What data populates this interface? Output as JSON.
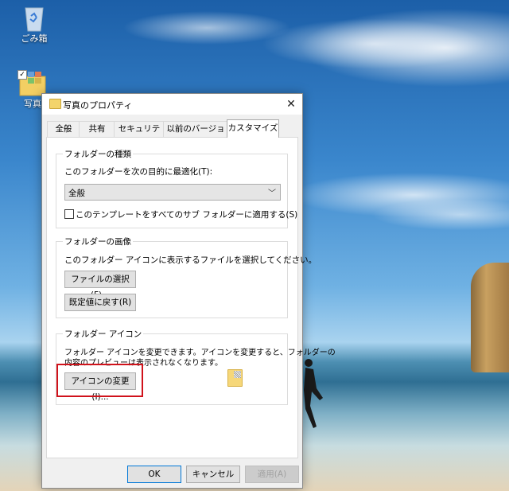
{
  "desktop": {
    "recycle_bin_label": "ごみ箱",
    "photo_folder_label": "写真"
  },
  "dialog": {
    "title": "写真のプロパティ",
    "close_glyph": "✕",
    "tabs": [
      {
        "label": "全般"
      },
      {
        "label": "共有"
      },
      {
        "label": "セキュリティ"
      },
      {
        "label": "以前のバージョン"
      },
      {
        "label": "カスタマイズ",
        "active": true
      }
    ],
    "folder_type": {
      "title": "フォルダーの種類",
      "optimize_label": "このフォルダーを次の目的に最適化(T):",
      "optimize_value": "全般",
      "apply_template_label": "このテンプレートをすべてのサブ フォルダーに適用する(S)",
      "apply_template_checked": false
    },
    "folder_picture": {
      "title": "フォルダーの画像",
      "description": "このフォルダー アイコンに表示するファイルを選択してください。",
      "choose_file_button": "ファイルの選択(F)...",
      "restore_default_button": "既定値に戻す(R)"
    },
    "folder_icon": {
      "title": "フォルダー アイコン",
      "description_line1": "フォルダー アイコンを変更できます。アイコンを変更すると、フォルダーの",
      "description_line2": "内容のプレビューは表示されなくなります。",
      "change_icon_button": "アイコンの変更(I)..."
    },
    "buttons": {
      "ok": "OK",
      "cancel": "キャンセル",
      "apply": "適用(A)"
    }
  },
  "colors": {
    "highlight": "#d0121b",
    "primary_border": "#0078d7"
  }
}
